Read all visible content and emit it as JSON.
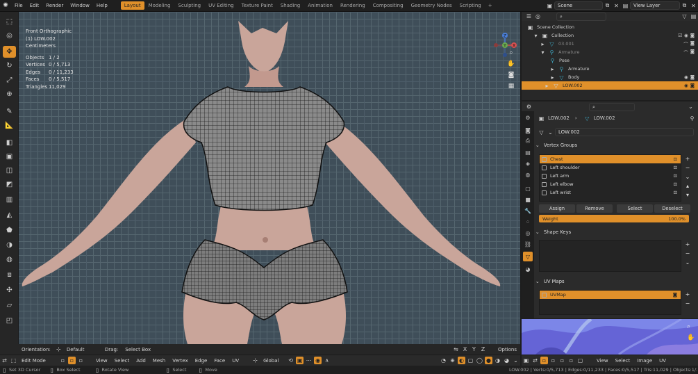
{
  "topbar": {
    "menus": [
      "File",
      "Edit",
      "Render",
      "Window",
      "Help"
    ],
    "workspaces": [
      "Layout",
      "Modeling",
      "Sculpting",
      "UV Editing",
      "Texture Paint",
      "Shading",
      "Animation",
      "Rendering",
      "Compositing",
      "Geometry Nodes",
      "Scripting"
    ],
    "active_workspace": "Layout",
    "scene": "Scene",
    "view_layer": "View Layer"
  },
  "viewport": {
    "view_name": "Front Orthographic",
    "object_name": "(1) LOW.002",
    "units": "Centimeters",
    "stats": [
      {
        "k": "Objects",
        "v": "1 / 2"
      },
      {
        "k": "Vertices",
        "v": "0 / 5,713"
      },
      {
        "k": "Edges",
        "v": "0 / 11,233"
      },
      {
        "k": "Faces",
        "v": "0 / 5,517"
      },
      {
        "k": "Triangles",
        "v": "11,029"
      }
    ],
    "gizmo": {
      "x": "X",
      "y": "Y",
      "z": "Z"
    }
  },
  "tool_header": {
    "orientation_label": "Orientation:",
    "orientation_value": "Default",
    "drag_label": "Drag:",
    "drag_value": "Select Box",
    "axes": [
      "X",
      "Y",
      "Z"
    ],
    "options": "Options"
  },
  "editor_header": {
    "mode": "Edit Mode",
    "menus": [
      "View",
      "Select",
      "Add",
      "Mesh",
      "Vertex",
      "Edge",
      "Face",
      "UV"
    ],
    "transform": "Global"
  },
  "outliner": {
    "title": "Scene Collection",
    "rows": [
      {
        "label": "Scene Collection",
        "indent": 0
      },
      {
        "label": "Collection",
        "indent": 1
      },
      {
        "label": "03.001",
        "indent": 2,
        "dim": true
      },
      {
        "label": "Armature",
        "indent": 2,
        "dim": true
      },
      {
        "label": "Pose",
        "indent": 3
      },
      {
        "label": "Armature",
        "indent": 3
      },
      {
        "label": "Body",
        "indent": 3
      },
      {
        "label": "LOW.002",
        "indent": 2,
        "selected": true
      }
    ]
  },
  "properties": {
    "breadcrumb_obj": "LOW.002",
    "breadcrumb_mesh": "LOW.002",
    "data_name": "LOW.002",
    "vertex_groups_title": "Vertex Groups",
    "vertex_groups": [
      "Chest",
      "Left shoulder",
      "Left arm",
      "Left elbow",
      "Left wrist"
    ],
    "buttons": [
      "Assign",
      "Remove",
      "Select",
      "Deselect"
    ],
    "weight_label": "Weight",
    "weight_value": "100.0%",
    "shape_keys_title": "Shape Keys",
    "uv_maps_title": "UV Maps",
    "uv_maps": [
      "UVMap"
    ]
  },
  "uv_editor": {
    "menus": [
      "View",
      "Select",
      "Image",
      "UV"
    ]
  },
  "status": {
    "items": [
      "Set 3D Cursor",
      "Box Select",
      "Rotate View",
      "Select",
      "Move"
    ],
    "right": "LOW.002 | Verts:0/5,713 | Edges:0/11,233 | Faces:0/5,517 | Tris:11,029 | Objects:1/2 | 3.1.0"
  },
  "colors": {
    "accent": "#e0902a",
    "viewport_bg": "#3f4e59",
    "skin": "#c9a59a"
  }
}
